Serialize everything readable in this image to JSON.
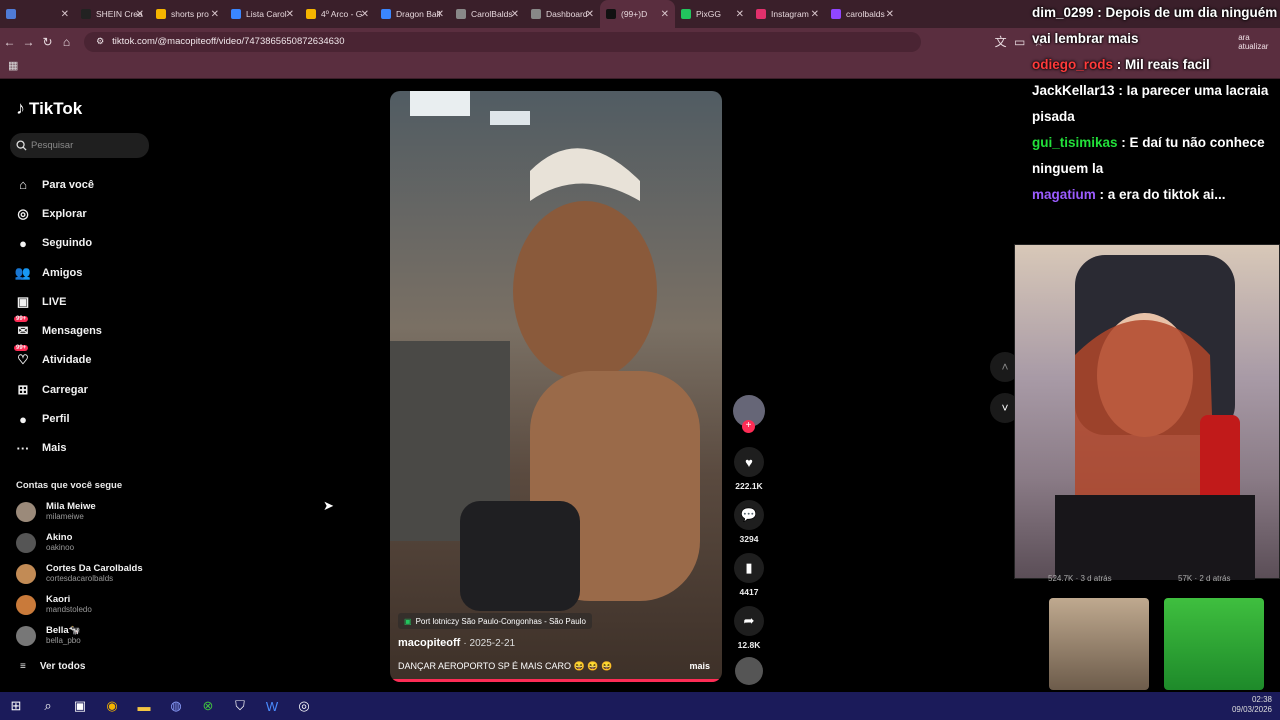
{
  "browser": {
    "tabs": [
      {
        "label": "",
        "color": "#4f7bd6"
      },
      {
        "label": "SHEIN Crea",
        "color": "#222"
      },
      {
        "label": "shorts pro",
        "color": "#f4b400"
      },
      {
        "label": "Lista Carol",
        "color": "#3a86ff"
      },
      {
        "label": "4º Arco - G",
        "color": "#f4b400"
      },
      {
        "label": "Dragon Ball",
        "color": "#3a86ff"
      },
      {
        "label": "CarolBalds",
        "color": "#888"
      },
      {
        "label": "Dashboard",
        "color": "#888"
      },
      {
        "label": "(99+)D",
        "color": "#111",
        "active": true
      },
      {
        "label": "PixGG",
        "color": "#22c55e"
      },
      {
        "label": "Instagram",
        "color": "#e1306c"
      },
      {
        "label": "carolbalds",
        "color": "#9146ff"
      }
    ],
    "url": "tiktok.com/@macopiteoff/video/7473865650872634630",
    "update_label": "ara atualizar"
  },
  "sidebar": {
    "logo": "TikTok",
    "search_placeholder": "Pesquisar",
    "items": [
      {
        "label": "Para você",
        "icon": "home-icon"
      },
      {
        "label": "Explorar",
        "icon": "compass-icon"
      },
      {
        "label": "Seguindo",
        "icon": "following-avatar"
      },
      {
        "label": "Amigos",
        "icon": "friends-icon"
      },
      {
        "label": "LIVE",
        "icon": "live-icon"
      },
      {
        "label": "Mensagens",
        "icon": "messages-icon",
        "badge": "99+"
      },
      {
        "label": "Atividade",
        "icon": "activity-icon",
        "badge": "99+"
      },
      {
        "label": "Carregar",
        "icon": "upload-icon"
      },
      {
        "label": "Perfil",
        "icon": "profile-icon"
      },
      {
        "label": "Mais",
        "icon": "more-icon"
      }
    ],
    "following_title": "Contas que você segue",
    "accounts": [
      {
        "name": "Mila Meiwe",
        "handle": "milameiwe",
        "color": "#9b8a7a"
      },
      {
        "name": "Akino",
        "handle": "oakinoo",
        "color": "#555"
      },
      {
        "name": "Cortes Da Carolbalds",
        "handle": "cortesdacarolbalds",
        "color": "#c28b55"
      },
      {
        "name": "Kaori",
        "handle": "mandstoledo",
        "color": "#c97a3a"
      },
      {
        "name": "Bella🐄",
        "handle": "bella_pbo",
        "color": "#777"
      }
    ],
    "see_all": "Ver todos"
  },
  "video": {
    "location": "Port lotniczy São Paulo-Congonhas - São Paulo",
    "author": "macopiteoff",
    "date": "2025-2-21",
    "caption": "DANÇAR AEROPORTO SP É MAIS CARO 😆 😆 😆",
    "more": "mais"
  },
  "actions": {
    "likes": "222.1K",
    "comments": "3294",
    "saves": "4417",
    "shares": "12.8K"
  },
  "chat": [
    {
      "user": "dim_0299",
      "text": "Depois de um dia ninguém vai lembrar mais",
      "color": "#ffffff"
    },
    {
      "user": "odiego_rods",
      "text": "Mil reais facil",
      "color": "#ff3b3b"
    },
    {
      "user": "JackKellar13",
      "text": "Ia parecer uma lacraia pisada",
      "color": "#ffffff"
    },
    {
      "user": "gui_tisimikas",
      "text": "E daí tu não conhece ninguem la",
      "color": "#22e03a"
    },
    {
      "user": "magatium",
      "text": "a era do tiktok ai...",
      "color": "#9b5cff"
    }
  ],
  "thumbs_stats": [
    "524.7K · 3 d atrás",
    "57K · 2 d atrás"
  ],
  "clock": {
    "time": "02:38",
    "date": "09/03/2026"
  }
}
